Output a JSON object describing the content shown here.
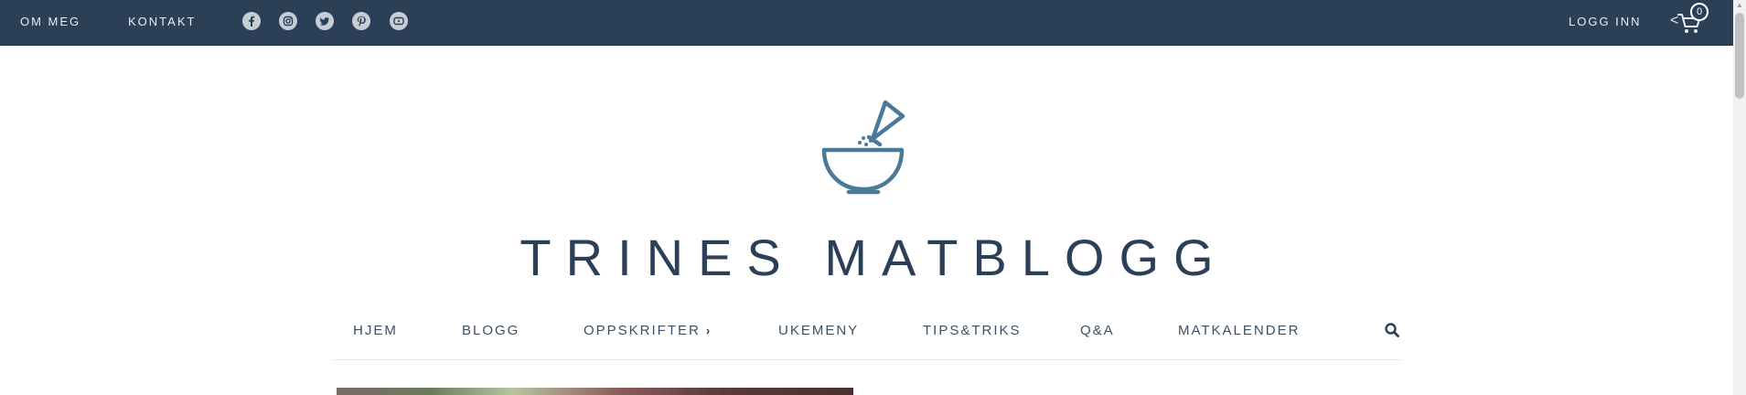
{
  "topbar": {
    "links": [
      {
        "label": "OM MEG"
      },
      {
        "label": "KONTAKT"
      }
    ],
    "social_icons": [
      "facebook-icon",
      "instagram-icon",
      "twitter-icon",
      "pinterest-icon",
      "youtube-icon"
    ],
    "login_label": "LOGG INN",
    "cart_count": "0",
    "back_chevron": "<"
  },
  "site": {
    "title": "TRINES MATBLOGG",
    "logo_icon": "mortar-salt-shaker-icon"
  },
  "nav": {
    "items": [
      {
        "label": "HJEM"
      },
      {
        "label": "BLOGG"
      },
      {
        "label": "OPPSKRIFTER"
      },
      {
        "label": "UKEMENY"
      },
      {
        "label": "TIPS&TRIKS"
      },
      {
        "label": "Q&A"
      },
      {
        "label": "MATKALENDER"
      }
    ],
    "dropdown_chevron": "›",
    "search_icon": "search-icon"
  },
  "colors": {
    "topbar": "#2b3f57",
    "accent": "#4a7a9a",
    "text": "#2b3f57"
  }
}
